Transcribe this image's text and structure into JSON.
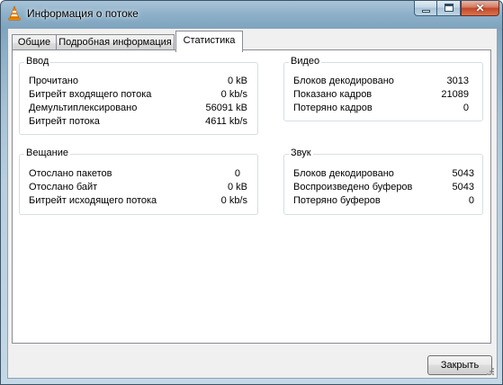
{
  "window": {
    "title": "Информация о потоке",
    "controls": {
      "minimize": "minimize",
      "maximize": "maximize",
      "close": "✕"
    }
  },
  "tabs": [
    {
      "label": "Общие",
      "active": false
    },
    {
      "label": "Подробная информация",
      "active": false
    },
    {
      "label": "Статистика",
      "active": true
    }
  ],
  "input": {
    "title": "Ввод",
    "rows": [
      {
        "label": "Прочитано",
        "value": "0 kB"
      },
      {
        "label": "Битрейт входящего потока",
        "value": "0 kb/s"
      },
      {
        "label": "Демультиплексировано",
        "value": "56091 kB"
      },
      {
        "label": "Битрейт потока",
        "value": "4611 kb/s"
      }
    ]
  },
  "video": {
    "title": "Видео",
    "rows": [
      {
        "label": "Блоков декодировано",
        "value": "3013"
      },
      {
        "label": "Показано кадров",
        "value": "21089"
      },
      {
        "label": "Потеряно кадров",
        "value": "0"
      }
    ]
  },
  "stream_out": {
    "title": "Вещание",
    "rows": [
      {
        "label": "Отослано пакетов",
        "value": "0"
      },
      {
        "label": "Отослано байт",
        "value": "0 kB"
      },
      {
        "label": "Битрейт исходящего потока",
        "value": "0 kb/s"
      }
    ]
  },
  "audio": {
    "title": "Звук",
    "rows": [
      {
        "label": "Блоков декодировано",
        "value": "5043"
      },
      {
        "label": "Воспроизведено буферов",
        "value": "5043"
      },
      {
        "label": "Потеряно буферов",
        "value": "0"
      }
    ]
  },
  "footer": {
    "close_label": "Закрыть"
  },
  "icons": {
    "app": "vlc-cone-icon",
    "grip": "resize-grip-icon"
  },
  "colors": {
    "close_button": "#c2462a",
    "group_border": "#d5dfe5",
    "panel_bg": "#ffffff"
  }
}
